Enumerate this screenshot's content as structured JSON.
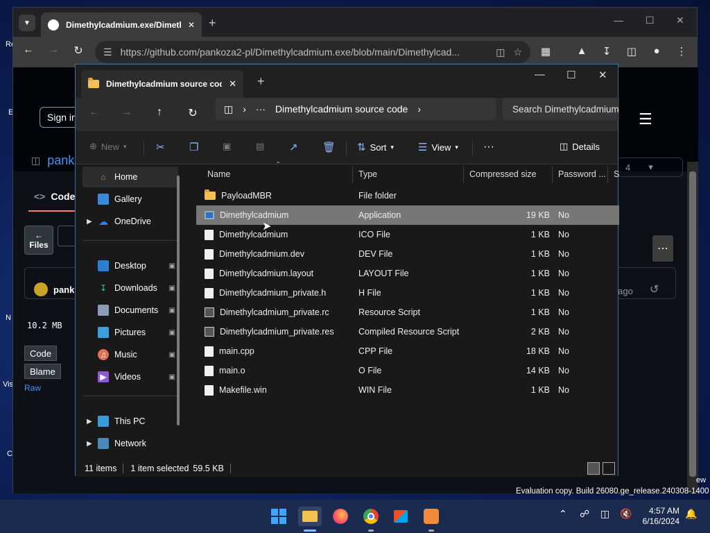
{
  "desktop": {
    "fragments": [
      "Re",
      "E",
      "N",
      "Vis",
      "C"
    ]
  },
  "chrome": {
    "tab_title": "Dimethylcadmium.exe/Dimeth",
    "url": "https://github.com/pankoza2-pl/Dimethylcadmium.exe/blob/main/Dimethylcad...",
    "new_tab": "+"
  },
  "github": {
    "sign_in": "Sign in",
    "repo_owner": "pank",
    "code_tab": "Code",
    "files_btn": "Files",
    "user": "pank",
    "file_size": "10.2 MB",
    "code_btn": "Code",
    "blame_btn": "Blame",
    "raw": "Raw",
    "ago": "s ago",
    "branch_count": "4"
  },
  "explorer": {
    "tab_title": "Dimethylcadmium source code",
    "breadcrumb": "Dimethylcadmium source code",
    "breadcrumb_dots": "···",
    "search_placeholder": "Search Dimethylcadmium",
    "cmd": {
      "new": "New",
      "sort": "Sort",
      "view": "View",
      "more": "···",
      "details": "Details"
    },
    "nav": [
      {
        "label": "Home",
        "icon": "home-icon"
      },
      {
        "label": "Gallery",
        "icon": "gallery-icon"
      },
      {
        "label": "OneDrive",
        "icon": "cloud-icon"
      },
      {
        "label": "Desktop",
        "icon": "desktop-icon"
      },
      {
        "label": "Downloads",
        "icon": "download-icon"
      },
      {
        "label": "Documents",
        "icon": "documents-icon"
      },
      {
        "label": "Pictures",
        "icon": "pictures-icon"
      },
      {
        "label": "Music",
        "icon": "music-icon"
      },
      {
        "label": "Videos",
        "icon": "videos-icon"
      },
      {
        "label": "This PC",
        "icon": "pc-icon"
      },
      {
        "label": "Network",
        "icon": "network-icon"
      }
    ],
    "columns": [
      "Name",
      "Type",
      "Compressed size",
      "Password ...",
      "Si"
    ],
    "files": [
      {
        "name": "PayloadMBR",
        "type": "File folder",
        "size": "",
        "password": "",
        "icon": "folder-icon"
      },
      {
        "name": "Dimethylcadmium",
        "type": "Application",
        "size": "19 KB",
        "password": "No",
        "icon": "application-icon"
      },
      {
        "name": "Dimethylcadmium",
        "type": "ICO File",
        "size": "1 KB",
        "password": "No",
        "icon": "file-icon"
      },
      {
        "name": "Dimethylcadmium.dev",
        "type": "DEV File",
        "size": "1 KB",
        "password": "No",
        "icon": "file-icon"
      },
      {
        "name": "Dimethylcadmium.layout",
        "type": "LAYOUT File",
        "size": "1 KB",
        "password": "No",
        "icon": "file-icon"
      },
      {
        "name": "Dimethylcadmium_private.h",
        "type": "H File",
        "size": "1 KB",
        "password": "No",
        "icon": "file-icon"
      },
      {
        "name": "Dimethylcadmium_private.rc",
        "type": "Resource Script",
        "size": "1 KB",
        "password": "No",
        "icon": "resource-icon"
      },
      {
        "name": "Dimethylcadmium_private.res",
        "type": "Compiled Resource Script",
        "size": "2 KB",
        "password": "No",
        "icon": "resource-icon"
      },
      {
        "name": "main.cpp",
        "type": "CPP File",
        "size": "18 KB",
        "password": "No",
        "icon": "file-icon"
      },
      {
        "name": "main.o",
        "type": "O File",
        "size": "14 KB",
        "password": "No",
        "icon": "file-icon"
      },
      {
        "name": "Makefile.win",
        "type": "WIN File",
        "size": "1 KB",
        "password": "No",
        "icon": "file-icon"
      }
    ],
    "selected_index": 1,
    "status": {
      "count": "11 items",
      "selected": "1 item selected",
      "size": "59.5 KB"
    }
  },
  "taskbar": {
    "eval_text": "Evaluation copy. Build 26080.ge_release.240308-1400",
    "time": "4:57 AM",
    "date": "6/16/2024",
    "ew": "ew"
  }
}
